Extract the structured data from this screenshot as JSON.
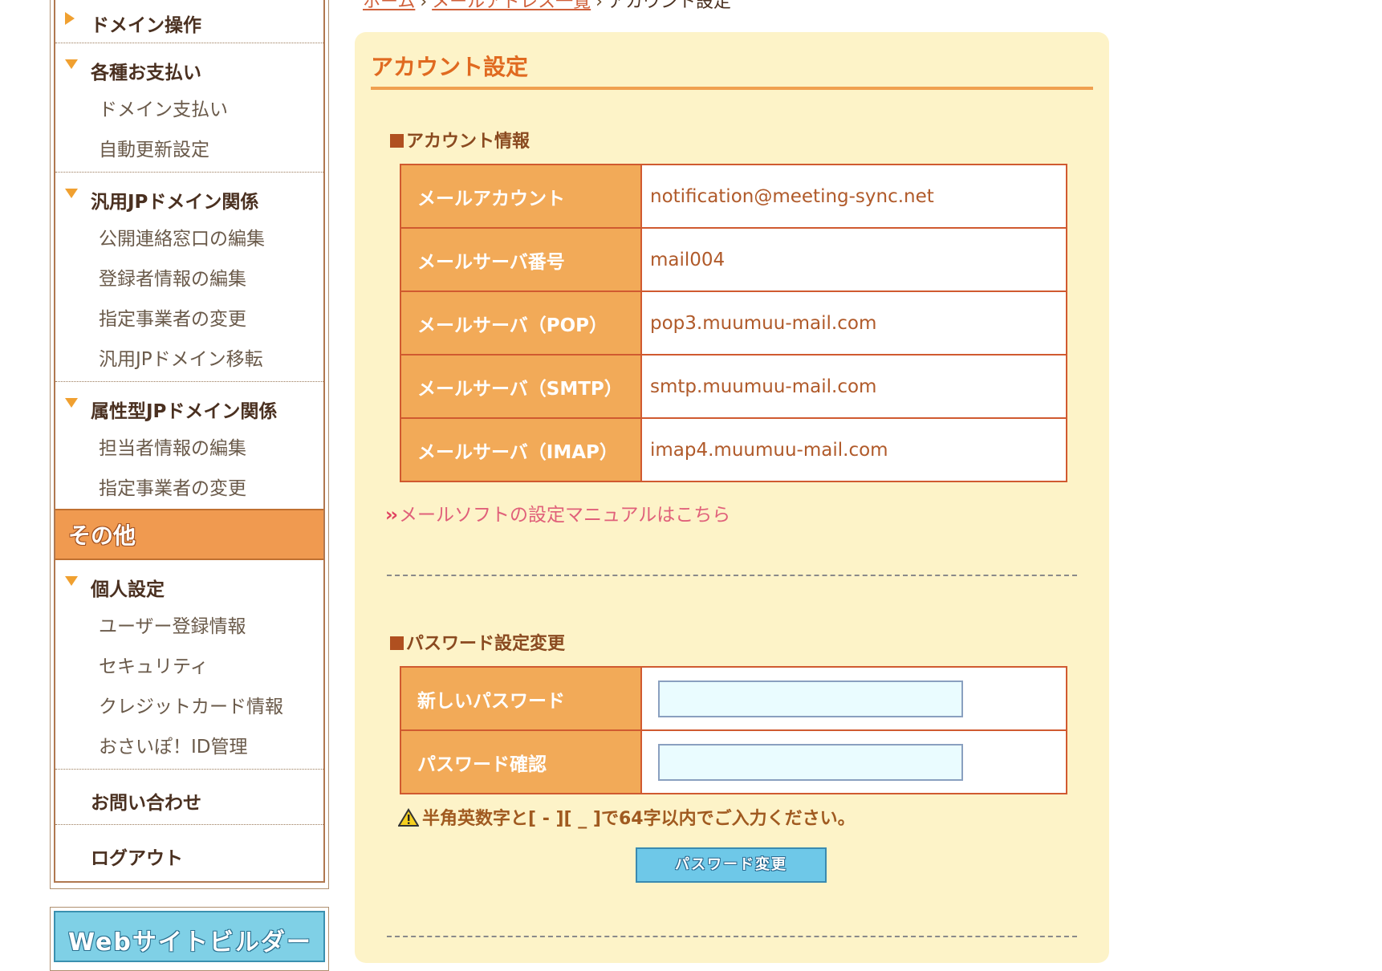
{
  "breadcrumb": {
    "home": "ホーム",
    "mail_list": "メールアドレス一覧",
    "current": "アカウント設定",
    "separator": "›"
  },
  "sidebar": {
    "domain_ops": "ドメイン操作",
    "payments": {
      "title": "各種お支払い",
      "items": [
        "ドメイン支払い",
        "自動更新設定"
      ]
    },
    "jp_general": {
      "title": "汎用JPドメイン関係",
      "items": [
        "公開連絡窓口の編集",
        "登録者情報の編集",
        "指定事業者の変更",
        "汎用JPドメイン移転"
      ]
    },
    "jp_attr": {
      "title": "属性型JPドメイン関係",
      "items": [
        "担当者情報の編集",
        "指定事業者の変更"
      ]
    },
    "other_section": "その他",
    "personal": {
      "title": "個人設定",
      "items": [
        "ユーザー登録情報",
        "セキュリティ",
        "クレジットカード情報",
        "おさいぽ！ID管理"
      ]
    },
    "contact": "お問い合わせ",
    "logout": "ログアウト",
    "banner": "Webサイトビルダー"
  },
  "main": {
    "title": "アカウント設定",
    "account_section": "アカウント情報",
    "rows": [
      {
        "label": "メールアカウント",
        "value": "notification@meeting-sync.net"
      },
      {
        "label": "メールサーバ番号",
        "value": "mail004"
      },
      {
        "label": "メールサーバ（POP）",
        "value": "pop3.muumuu-mail.com"
      },
      {
        "label": "メールサーバ（SMTP）",
        "value": "smtp.muumuu-mail.com"
      },
      {
        "label": "メールサーバ（IMAP）",
        "value": "imap4.muumuu-mail.com"
      }
    ],
    "manual_link": "メールソフトの設定マニュアルはこちら",
    "password_section": "パスワード設定変更",
    "new_password_label": "新しいパスワード",
    "confirm_password_label": "パスワード確認",
    "new_password_value": "",
    "confirm_password_value": "",
    "warning": "半角英数字と[ - ][ _ ]で64字以内でご入力ください。",
    "change_button": "パスワード変更"
  },
  "colors": {
    "accent": "#e06a20",
    "table_header": "#f2aa58",
    "table_border": "#d05a30",
    "panel_bg": "#fdf3c8",
    "section_bar": "#f09a50",
    "button": "#6ec8e8"
  }
}
